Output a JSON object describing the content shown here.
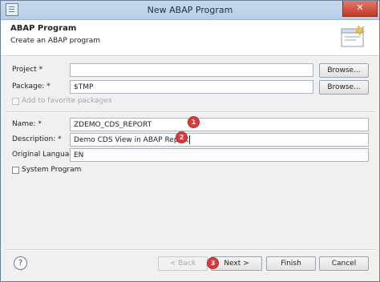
{
  "window": {
    "title": "New ABAP Program",
    "close_glyph": "✕"
  },
  "header": {
    "title": "ABAP Program",
    "subtitle": "Create an ABAP program",
    "icon": "wizard-banner-icon"
  },
  "form": {
    "project": {
      "label": "Project *",
      "value": "",
      "browse_label": "Browse..."
    },
    "package": {
      "label": "Package: *",
      "value": "$TMP",
      "browse_label": "Browse..."
    },
    "favorite": {
      "label": "Add to favorite packages",
      "checked": false,
      "disabled": true
    },
    "name": {
      "label": "Name: *",
      "value": "ZDEMO_CDS_REPORT"
    },
    "description": {
      "label": "Description: *",
      "value": "Demo CDS View in ABAP Report"
    },
    "language": {
      "label": "Original Language:",
      "value": "EN"
    },
    "system_program": {
      "label": "System Program",
      "checked": false
    }
  },
  "markers": {
    "m1": "1",
    "m2": "2",
    "m3": "3"
  },
  "footer": {
    "help_glyph": "?",
    "back_label": "< Back",
    "next_label": "Next >",
    "finish_label": "Finish",
    "cancel_label": "Cancel"
  },
  "colors": {
    "marker": "#d93a3a",
    "titlebar": "#c7d9ee",
    "close": "#c1392b"
  }
}
